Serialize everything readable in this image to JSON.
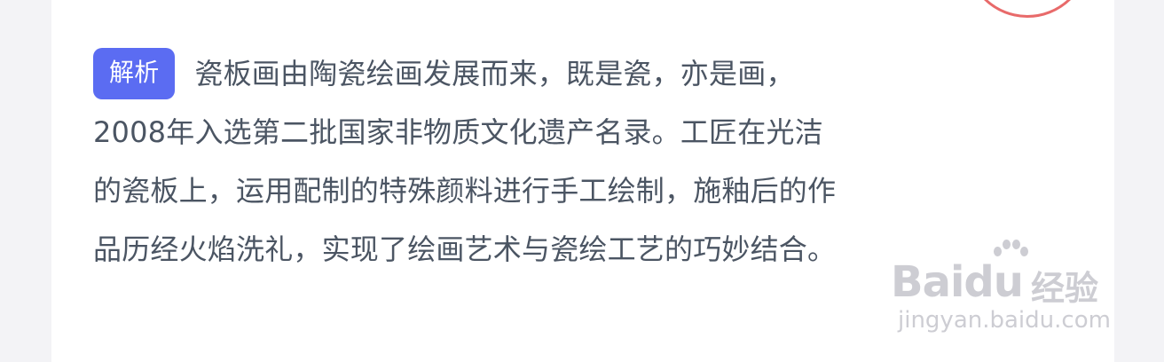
{
  "analysis": {
    "tag": "解析",
    "lines": [
      "瓷板画由陶瓷绘画发展而来，既是瓷，亦是画，",
      "2008年入选第二批国家非物质文化遗产名录。工匠在光洁",
      "的瓷板上，运用配制的特殊颜料进行手工绘制，施釉后的作",
      "品历经火焰洗礼，实现了绘画艺术与瓷绘工艺的巧妙结合。"
    ]
  },
  "watermark": {
    "logo": "Baidu",
    "brand_cn": "经验",
    "url": "jingyan.baidu.com"
  },
  "colors": {
    "tag_bg": "#5b6cf2",
    "text": "#4b5563",
    "circle": "#e86a6a"
  }
}
